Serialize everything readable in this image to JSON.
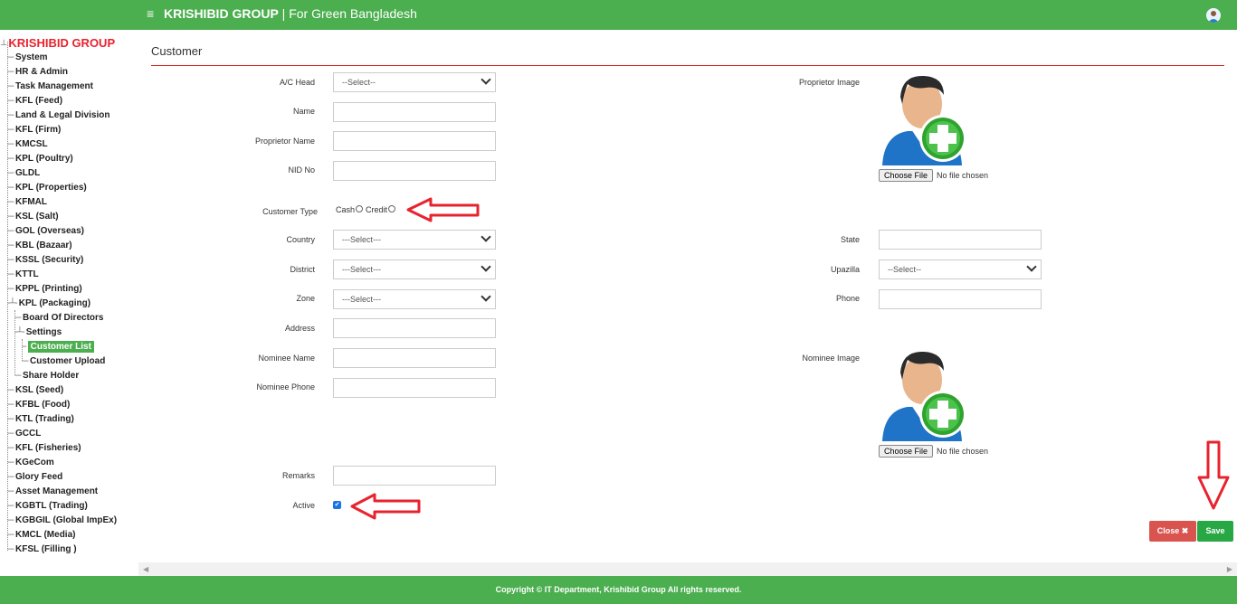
{
  "header": {
    "menu_icon": "hamburger-icon",
    "brand_bold": "KRISHIBID GROUP",
    "brand_rest": " | For Green Bangladesh"
  },
  "sidebar": {
    "root": "KRISHIBID GROUP",
    "items": [
      {
        "label": "System"
      },
      {
        "label": "HR & Admin"
      },
      {
        "label": "Task Management"
      },
      {
        "label": "KFL (Feed)"
      },
      {
        "label": "Land & Legal Division"
      },
      {
        "label": "KFL (Firm)"
      },
      {
        "label": "KMCSL"
      },
      {
        "label": "KPL (Poultry)"
      },
      {
        "label": "GLDL"
      },
      {
        "label": "KPL (Properties)"
      },
      {
        "label": "KFMAL"
      },
      {
        "label": "KSL (Salt)"
      },
      {
        "label": "GOL (Overseas)"
      },
      {
        "label": "KBL (Bazaar)"
      },
      {
        "label": "KSSL (Security)"
      },
      {
        "label": "KTTL"
      },
      {
        "label": "KPPL (Printing)"
      },
      {
        "label": "KPL (Packaging)"
      },
      {
        "label": "Board Of Directors"
      },
      {
        "label": "Settings"
      },
      {
        "label": "Customer List"
      },
      {
        "label": "Customer Upload"
      },
      {
        "label": "Share Holder"
      },
      {
        "label": "KSL (Seed)"
      },
      {
        "label": "KFBL (Food)"
      },
      {
        "label": "KTL (Trading)"
      },
      {
        "label": "GCCL"
      },
      {
        "label": "KFL (Fisheries)"
      },
      {
        "label": "KGeCom"
      },
      {
        "label": "Glory Feed"
      },
      {
        "label": "Asset Management"
      },
      {
        "label": "KGBTL (Trading)"
      },
      {
        "label": "KGBGIL (Global ImpEx)"
      },
      {
        "label": "KMCL (Media)"
      },
      {
        "label": "KFSL (Filling )"
      }
    ]
  },
  "page": {
    "title": "Customer"
  },
  "form": {
    "ac_head": {
      "label": "A/C Head",
      "value": "--Select--"
    },
    "name": {
      "label": "Name",
      "value": ""
    },
    "proprietor_name": {
      "label": "Proprietor Name",
      "value": ""
    },
    "nid": {
      "label": "NID No",
      "value": ""
    },
    "customer_type": {
      "label": "Customer Type",
      "options": [
        "Cash",
        "Credit"
      ]
    },
    "country": {
      "label": "Country",
      "value": "---Select---"
    },
    "district": {
      "label": "District",
      "value": "---Select---"
    },
    "zone": {
      "label": "Zone",
      "value": "---Select---"
    },
    "address": {
      "label": "Address",
      "value": ""
    },
    "nominee_name": {
      "label": "Nominee Name",
      "value": ""
    },
    "nominee_phone": {
      "label": "Nominee Phone",
      "value": ""
    },
    "remarks": {
      "label": "Remarks",
      "value": ""
    },
    "active": {
      "label": "Active",
      "checked": true
    },
    "proprietor_image": {
      "label": "Proprietor Image",
      "button": "Choose File",
      "status": "No file chosen"
    },
    "state": {
      "label": "State",
      "value": ""
    },
    "upazilla": {
      "label": "Upazilla",
      "value": "--Select--"
    },
    "phone": {
      "label": "Phone",
      "value": ""
    },
    "nominee_image": {
      "label": "Nominee Image",
      "button": "Choose File",
      "status": "No file chosen"
    }
  },
  "buttons": {
    "close": "Close ✖",
    "save": "Save"
  },
  "footer": {
    "text": "Copyright © IT Department, Krishibid Group All rights reserved."
  },
  "colors": {
    "brand_green": "#4bae4f",
    "title_rule": "#d9251d",
    "close_red": "#d9534f",
    "save_green": "#28a745",
    "annotation_red": "#e8232f"
  }
}
